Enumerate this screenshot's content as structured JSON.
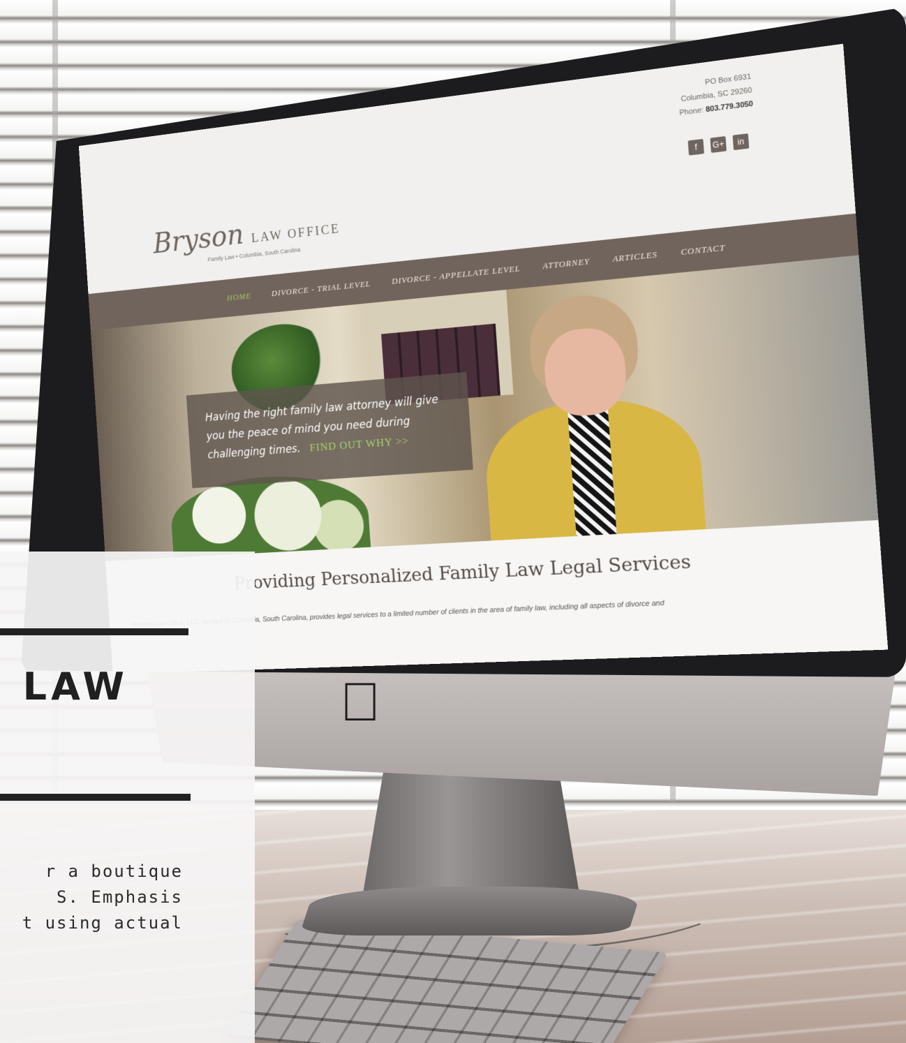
{
  "site": {
    "contact": {
      "line1": "PO Box 6931",
      "line2": "Columbia, SC 29260",
      "phone_label": "Phone:",
      "phone": "803.779.3050"
    },
    "social": [
      "f",
      "G+",
      "in"
    ],
    "logo": {
      "script": "Bryson",
      "caps": "LAW OFFICE",
      "tagline": "Family Law • Columbia, South Carolina"
    },
    "nav": [
      {
        "label": "HOME",
        "active": true
      },
      {
        "label": "DIVORCE - TRIAL LEVEL",
        "active": false
      },
      {
        "label": "DIVORCE - APPELLATE LEVEL",
        "active": false
      },
      {
        "label": "ATTORNEY",
        "active": false
      },
      {
        "label": "ARTICLES",
        "active": false
      },
      {
        "label": "CONTACT",
        "active": false
      }
    ],
    "hero": {
      "text": "Having the right family law attorney will give you the peace of mind you need during challenging times.",
      "cta": "FIND OUT WHY >>"
    },
    "content": {
      "title": "Providing Personalized Family Law Legal Services",
      "text": "Bryson Law Office, LLC, located in Columbia, South Carolina, provides legal services to a limited number of clients in the area of family law, including all aspects of divorce and"
    }
  },
  "card": {
    "title": "LAW",
    "desc_lines": [
      "r a boutique",
      "S. Emphasis",
      "t using actual"
    ]
  },
  "colors": {
    "nav_bg": "#71645c",
    "nav_active": "#9fc95f",
    "cta": "#a9d36a",
    "card_bg": "#f6f5f5"
  }
}
